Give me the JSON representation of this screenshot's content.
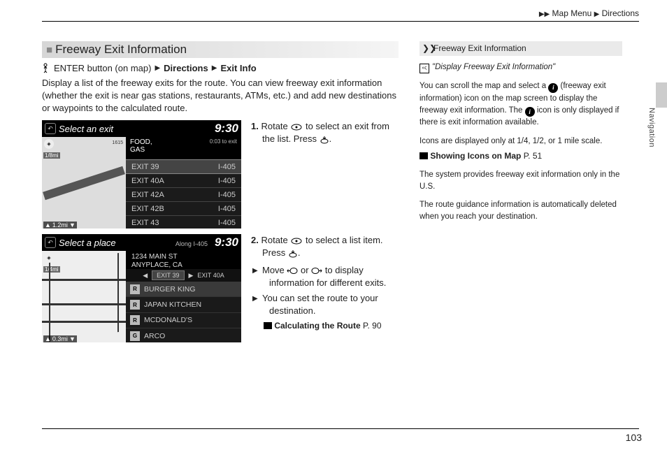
{
  "breadcrumb": {
    "item1": "Map Menu",
    "item2": "Directions"
  },
  "section_title": "Freeway Exit Information",
  "nav_path": {
    "enter_label": "ENTER button (on map)",
    "step1": "Directions",
    "step2": "Exit Info"
  },
  "intro": "Display a list of the freeway exits for the route. You can view freeway exit information (whether the exit is near gas stations, restaurants, ATMs, etc.) and add new destinations or waypoints to the calculated route.",
  "screenshot1": {
    "title": "Select an exit",
    "clock": "9:30",
    "scale_top": "1/8mi",
    "scale_bottom": "1.2mi",
    "route_label_small": "1615",
    "info_label": "FOOD,",
    "info_label2": "GAS",
    "eta": "0:03 to exit",
    "exits": [
      {
        "name": "EXIT 39",
        "hwy": "I-405"
      },
      {
        "name": "EXIT 40A",
        "hwy": "I-405"
      },
      {
        "name": "EXIT 42A",
        "hwy": "I-405"
      },
      {
        "name": "EXIT 42B",
        "hwy": "I-405"
      },
      {
        "name": "EXIT 43",
        "hwy": "I-405"
      }
    ]
  },
  "screenshot2": {
    "title": "Select a place",
    "along": "Along I-405",
    "clock": "9:30",
    "scale_top": "1/4mi",
    "scale_bottom": "0.3mi",
    "addr1": "1234 MAIN ST",
    "addr2": "ANYPLACE, CA",
    "tab_current": "EXIT 39",
    "tab_next": "EXIT 40A",
    "pois": [
      {
        "icon": "R",
        "name": "BURGER KING"
      },
      {
        "icon": "R",
        "name": "JAPAN KITCHEN"
      },
      {
        "icon": "R",
        "name": "MCDONALD'S"
      },
      {
        "icon": "G",
        "name": "ARCO"
      }
    ]
  },
  "step1": {
    "num": "1.",
    "text_a": "Rotate ",
    "text_b": " to select an exit from the list. Press ",
    "text_c": "."
  },
  "step2": {
    "num": "2.",
    "text_a": "Rotate ",
    "text_b": " to select a list item. Press ",
    "text_c": ".",
    "sub1_a": "Move ",
    "sub1_b": " or ",
    "sub1_c": " to display information for different exits.",
    "sub2": "You can set the route to your destination.",
    "xref_label": "Calculating the Route",
    "xref_page": "P. 90"
  },
  "right_col": {
    "header": "Freeway Exit Information",
    "voice_cmd": "\"Display Freeway Exit Information\"",
    "para1_a": "You can scroll the map and select a ",
    "para1_b": " (freeway exit information) icon on the map screen to display the freeway exit information. The ",
    "para1_c": " icon is only displayed if there is exit information available.",
    "para2": "Icons are displayed only at 1/4, 1/2, or 1 mile scale.",
    "xref_label": "Showing Icons on Map",
    "xref_page": "P. 51",
    "para3": "The system provides freeway exit information only in the U.S.",
    "para4": "The route guidance information is automatically deleted when you reach your destination."
  },
  "side_label": "Navigation",
  "page_number": "103"
}
